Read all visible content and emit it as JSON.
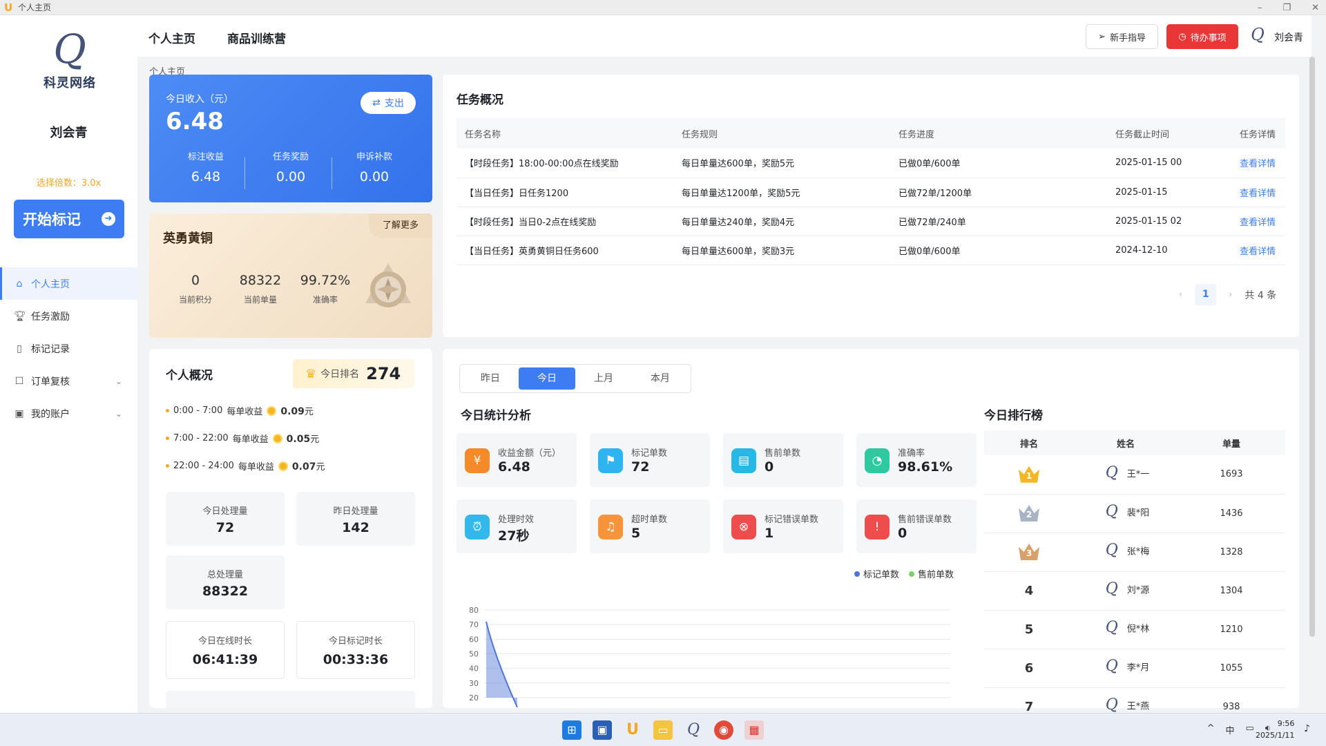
{
  "window": {
    "title": "个人主页",
    "min_icon": "minimize-icon",
    "max_icon": "restore-icon",
    "close_icon": "close-icon"
  },
  "sidebar": {
    "brand_name": "科灵网络",
    "user_name": "刘会青",
    "multiplier": "选择倍数：3.0x",
    "start_button": "开始标记",
    "items": [
      {
        "label": "个人主页",
        "icon": "home-icon",
        "active": true
      },
      {
        "label": "任务激励",
        "icon": "trophy-icon"
      },
      {
        "label": "标记记录",
        "icon": "bookmark-icon"
      },
      {
        "label": "订单复核",
        "icon": "checkbox-icon",
        "expandable": true
      },
      {
        "label": "我的账户",
        "icon": "wallet-icon",
        "expandable": true
      }
    ]
  },
  "topnav": {
    "tabs": [
      "个人主页",
      "商品训练营"
    ],
    "guide_button": "新手指导",
    "todo_button": "待办事项",
    "user_name": "刘会青"
  },
  "breadcrumb": "个人主页",
  "income": {
    "label": "今日收入（元）",
    "value": "6.48",
    "payout_button": "支出",
    "subs": [
      {
        "label": "标注收益",
        "value": "6.48"
      },
      {
        "label": "任务奖励",
        "value": "0.00"
      },
      {
        "label": "申诉补款",
        "value": "0.00"
      }
    ]
  },
  "level": {
    "title": "英勇黄铜",
    "more": "了解更多",
    "stats": [
      {
        "value": "0",
        "label": "当前积分"
      },
      {
        "value": "88322",
        "label": "当前单量"
      },
      {
        "value": "99.72%",
        "label": "准确率"
      }
    ]
  },
  "overview": {
    "title": "个人概况",
    "rank_label": "今日排名",
    "rank_value": "274",
    "rates": [
      {
        "time": "0:00 - 7:00",
        "label": "每单收益",
        "value": "0.09",
        "unit": "元"
      },
      {
        "time": "7:00 - 22:00",
        "label": "每单收益",
        "value": "0.05",
        "unit": "元"
      },
      {
        "time": "22:00 - 24:00",
        "label": "每单收益",
        "value": "0.07",
        "unit": "元"
      }
    ],
    "today_processed_label": "今日处理量",
    "today_processed": "72",
    "yesterday_processed_label": "昨日处理量",
    "yesterday_processed": "142",
    "total_processed_label": "总处理量",
    "total_processed": "88322",
    "online_label": "今日在线时长",
    "online_value": "06:41:39",
    "marking_label": "今日标记时长",
    "marking_value": "00:33:36"
  },
  "tasks": {
    "title": "任务概况",
    "headers": [
      "任务名称",
      "任务规则",
      "任务进度",
      "任务截止时间",
      "任务详情"
    ],
    "rows": [
      [
        "【时段任务】18:00-00:00点在线奖励",
        "每日单量达600单，奖励5元",
        "已做0单/600单",
        "2025-01-15 00",
        "查看详情"
      ],
      [
        "【当日任务】日任务1200",
        "每日单量达1200单，奖励5元",
        "已做72单/1200单",
        "2025-01-15",
        "查看详情"
      ],
      [
        "【时段任务】当日0-2点在线奖励",
        "每日单量达240单，奖励4元",
        "已做72单/240单",
        "2025-01-15 02",
        "查看详情"
      ],
      [
        "【当日任务】英勇黄铜日任务600",
        "每日单量达600单，奖励3元",
        "已做0单/600单",
        "2024-12-10",
        "查看详情"
      ]
    ],
    "page": "1",
    "total": "共 4 条"
  },
  "stats": {
    "segments": [
      "昨日",
      "今日",
      "上月",
      "本月"
    ],
    "active_segment": "今日",
    "title": "今日统计分析",
    "kpis": [
      {
        "label": "收益金额（元）",
        "value": "6.48",
        "color": "#f58a2b",
        "icon": "coin-icon"
      },
      {
        "label": "标记单数",
        "value": "72",
        "color": "#2fb4f0",
        "icon": "flag-icon"
      },
      {
        "label": "售前单数",
        "value": "0",
        "color": "#28b8e6",
        "icon": "document-icon"
      },
      {
        "label": "准确率",
        "value": "98.61%",
        "color": "#2ec9a0",
        "icon": "pie-icon"
      },
      {
        "label": "处理时效",
        "value": "27秒",
        "color": "#33b8ec",
        "icon": "alarm-icon"
      },
      {
        "label": "超时单数",
        "value": "5",
        "color": "#f5943a",
        "icon": "bell-icon"
      },
      {
        "label": "标记错误单数",
        "value": "1",
        "color": "#ee4d4d",
        "icon": "error-icon"
      },
      {
        "label": "售前错误单数",
        "value": "0",
        "color": "#ee4d4d",
        "icon": "alert-icon"
      }
    ],
    "legend": [
      {
        "name": "标记单数",
        "color": "#4d74d8"
      },
      {
        "name": "售前单数",
        "color": "#7dcf6a"
      }
    ]
  },
  "chart_data": {
    "type": "area",
    "title": "",
    "xlabel": "",
    "ylabel": "",
    "ylim": [
      20,
      80
    ],
    "y_ticks": [
      "80",
      "70",
      "60",
      "50",
      "40",
      "30",
      "20"
    ],
    "grid": true,
    "legend_position": "top-right",
    "series": [
      {
        "name": "标记单数",
        "values": [
          72,
          20
        ],
        "color": "#4d74d8"
      },
      {
        "name": "售前单数",
        "values": [
          0,
          0
        ],
        "color": "#7dcf6a"
      }
    ]
  },
  "ranking": {
    "title": "今日排行榜",
    "headers": [
      "排名",
      "姓名",
      "单量"
    ],
    "rows": [
      {
        "rank": "1",
        "name": "王*一",
        "count": "1693",
        "medal": "gold"
      },
      {
        "rank": "2",
        "name": "裴*阳",
        "count": "1436",
        "medal": "silver"
      },
      {
        "rank": "3",
        "name": "张*梅",
        "count": "1328",
        "medal": "bronze"
      },
      {
        "rank": "4",
        "name": "刘*源",
        "count": "1304"
      },
      {
        "rank": "5",
        "name": "倪*林",
        "count": "1210"
      },
      {
        "rank": "6",
        "name": "李*月",
        "count": "1055"
      },
      {
        "rank": "7",
        "name": "王*燕",
        "count": "938"
      }
    ]
  },
  "taskbar": {
    "icons": [
      "windows-start-icon",
      "store-icon",
      "app-u-icon",
      "folder-icon",
      "app-q-icon",
      "chrome-icon",
      "app-calendar-icon"
    ],
    "tray": [
      "^",
      "中"
    ],
    "time": "9:56",
    "date": "2025/1/11"
  }
}
